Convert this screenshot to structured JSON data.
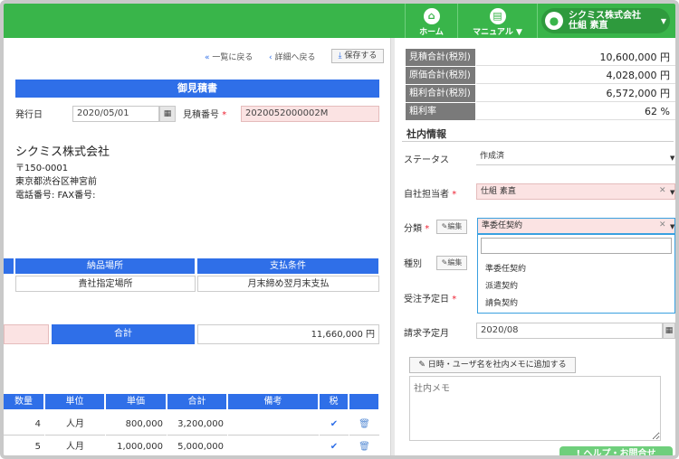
{
  "nav": {
    "home": "ホーム",
    "manual": "マニュアル ▼",
    "company": "シクミス株式会社",
    "user": "仕組 素直"
  },
  "toolbar": {
    "back_list": "一覧に戻る",
    "back_detail": "詳細へ戻る",
    "save": "保存する"
  },
  "doc": {
    "title": "御見積書",
    "date_label": "発行日",
    "date_value": "2020/05/01",
    "estimate_no_label": "見積番号",
    "estimate_no_value": "2020052000002M",
    "company_name": "シクミス株式会社",
    "postal": "〒150-0001",
    "address": "東京都渋谷区神宮前",
    "phone": "電話番号:  FAX番号:"
  },
  "delivery_table": {
    "headers": [
      "納品場所",
      "支払条件"
    ],
    "values": [
      "貴社指定場所",
      "月末締め翌月末支払"
    ]
  },
  "total": {
    "label": "合計",
    "value": "11,660,000 円"
  },
  "items_table": {
    "headers": [
      "数量",
      "単位",
      "単価",
      "合計",
      "備考",
      "税"
    ],
    "rows": [
      {
        "qty": "4",
        "unit": "人月",
        "price": "800,000",
        "total": "3,200,000"
      },
      {
        "qty": "5",
        "unit": "人月",
        "price": "1,000,000",
        "total": "5,000,000"
      }
    ]
  },
  "summary": [
    {
      "label": "見積合計(税別)",
      "value": "10,600,000 円"
    },
    {
      "label": "原価合計(税別)",
      "value": "4,028,000 円"
    },
    {
      "label": "粗利合計(税別)",
      "value": "6,572,000 円"
    },
    {
      "label": "粗利率",
      "value": "62 %"
    }
  ],
  "internal": {
    "section_title": "社内情報",
    "status_label": "ステータス",
    "status_value": "作成済",
    "owner_label": "自社担当者",
    "owner_value": "仕組 素直",
    "category_label": "分類",
    "category_value": "準委任契約",
    "edit_label": "編集",
    "type_label": "種別",
    "order_date_label": "受注予定日",
    "billing_month_label": "請求予定月",
    "billing_month_value": "2020/08",
    "category_options": [
      "準委任契約",
      "派遣契約",
      "請負契約"
    ],
    "memo_button": "日時・ユーザ名を社内メモに追加する",
    "memo_placeholder": "社内メモ",
    "help": "ヘルプ・お問合せ"
  },
  "colors": {
    "brand_green": "#39b54a",
    "header_blue": "#2f6fe8",
    "required_red": "#e23333"
  }
}
